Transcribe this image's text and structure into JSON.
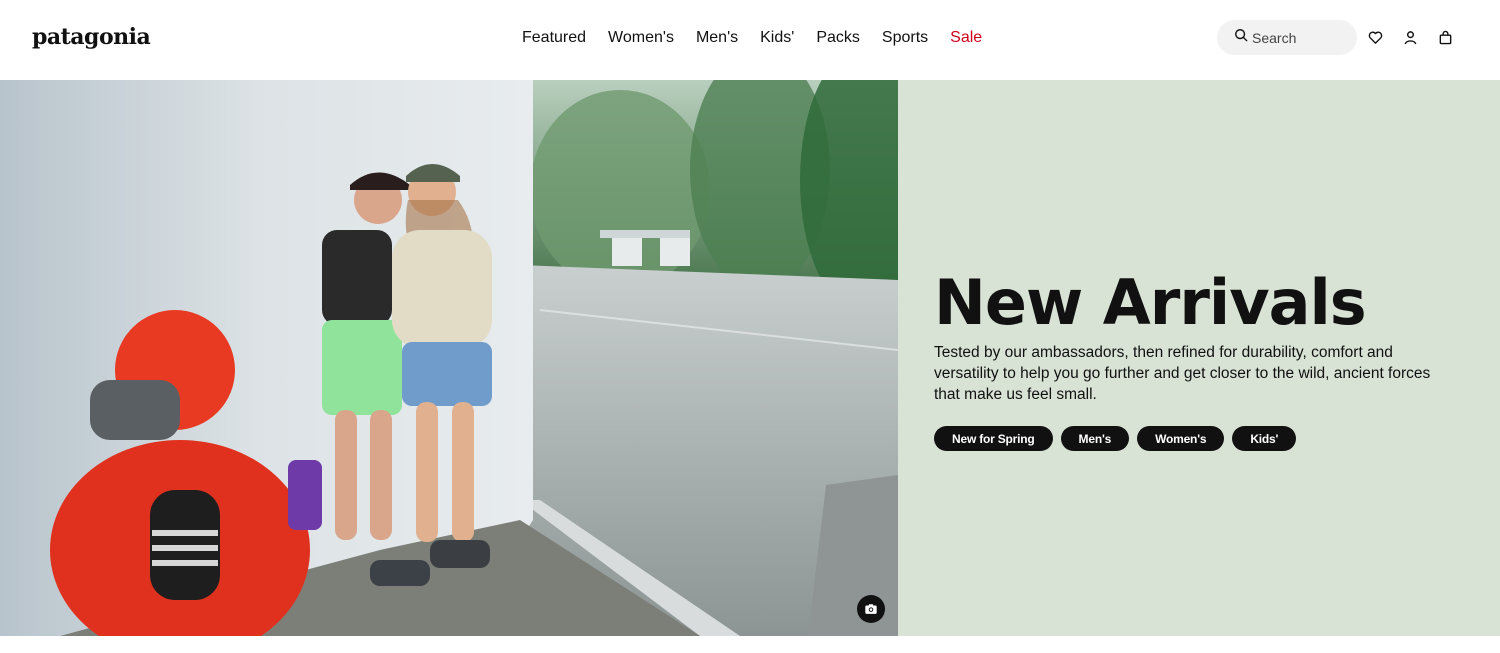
{
  "header": {
    "logo": "patagonia",
    "nav": [
      "Featured",
      "Women's",
      "Men's",
      "Kids'",
      "Packs",
      "Sports",
      "Sale"
    ],
    "search_placeholder": "Search",
    "icons": [
      "search-icon",
      "heart-icon",
      "user-icon",
      "bag-icon"
    ],
    "sale_color": "#d0021b"
  },
  "hero": {
    "title": "New Arrivals",
    "description": "Tested by our ambassadors, then refined for durability, comfort and versatility to help you go further and get closer to the wild, ancient forces that make us feel small.",
    "buttons": [
      "New for Spring",
      "Men's",
      "Women's",
      "Kids'"
    ],
    "panel_color": "#d9e3d5",
    "image_icon": "camera-icon"
  }
}
